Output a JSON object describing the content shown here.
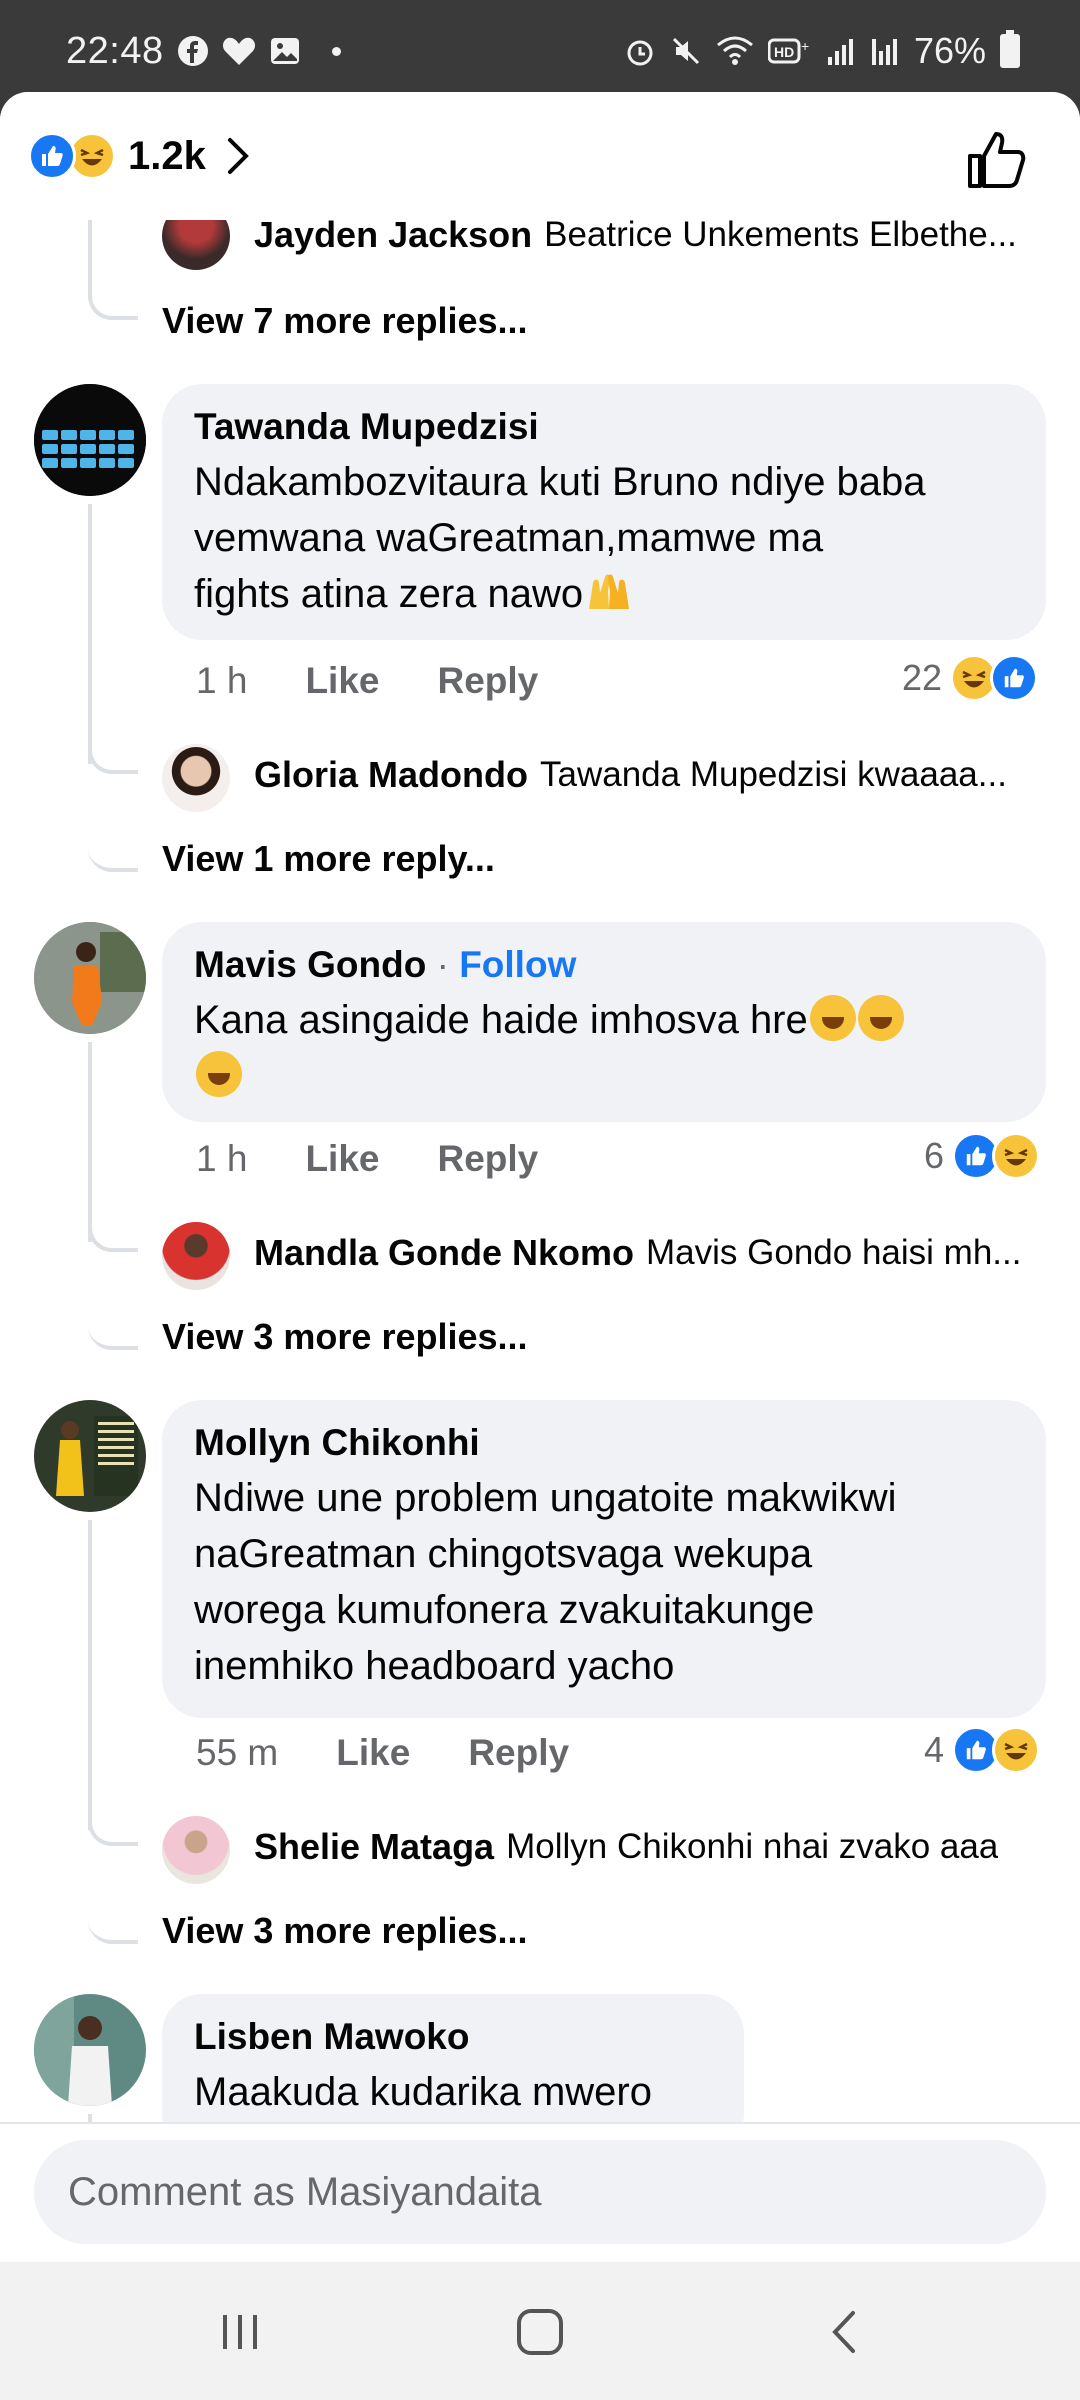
{
  "status_bar": {
    "time": "22:48",
    "battery": "76%",
    "left_icons": [
      "facebook-icon",
      "heart-icon",
      "gallery-icon"
    ],
    "right_icons": [
      "alarm-icon",
      "mute-icon",
      "wifi-icon",
      "hd-icon",
      "signal-icon",
      "signal-icon"
    ]
  },
  "reactions_header": {
    "count": "1.2k",
    "icons": [
      "like-reaction-icon",
      "haha-reaction-icon"
    ]
  },
  "top_reply": {
    "name": "Jayden Jackson",
    "text": "Beatrice Unkements Elbethe...",
    "more": "View 7 more replies..."
  },
  "comments": [
    {
      "name": "Tawanda Mupedzisi",
      "text_lines": [
        "Ndakambozvitaura kuti Bruno ndiye baba",
        "vemwana waGreatman,mamwe ma",
        "fights atina zera nawo"
      ],
      "time": "1 h",
      "like": "Like",
      "reply": "Reply",
      "reaction_count": "22",
      "reply_preview": {
        "name": "Gloria Madondo",
        "text": "Tawanda Mupedzisi kwaaaa..."
      },
      "more": "View 1 more reply..."
    },
    {
      "name": "Mavis Gondo",
      "follow": "Follow",
      "text_lines": [
        "Kana asingaide haide imhosva hre"
      ],
      "time": "1 h",
      "like": "Like",
      "reply": "Reply",
      "reaction_count": "6",
      "reply_preview": {
        "name": "Mandla Gonde Nkomo",
        "text": "Mavis Gondo haisi mh..."
      },
      "more": "View 3 more replies..."
    },
    {
      "name": "Mollyn Chikonhi",
      "text_lines": [
        "Ndiwe une problem  ungatoite makwikwi",
        "naGreatman  chingotsvaga wekupa",
        "worega kumufonera zvakuitakunge",
        "inemhiko headboard yacho"
      ],
      "time": "55 m",
      "like": "Like",
      "reply": "Reply",
      "reaction_count": "4",
      "reply_preview": {
        "name": "Shelie Mataga",
        "text": "Mollyn Chikonhi nhai zvako aaa"
      },
      "more": "View 3 more replies..."
    },
    {
      "name": "Lisben Mawoko",
      "text_lines": [
        "Maakuda kudarika mwero"
      ]
    }
  ],
  "composer": {
    "placeholder": "Comment as Masiyandaita"
  },
  "colors": {
    "accent": "#1877f2",
    "bubble": "#f0f2f5",
    "muted": "#65676b"
  }
}
